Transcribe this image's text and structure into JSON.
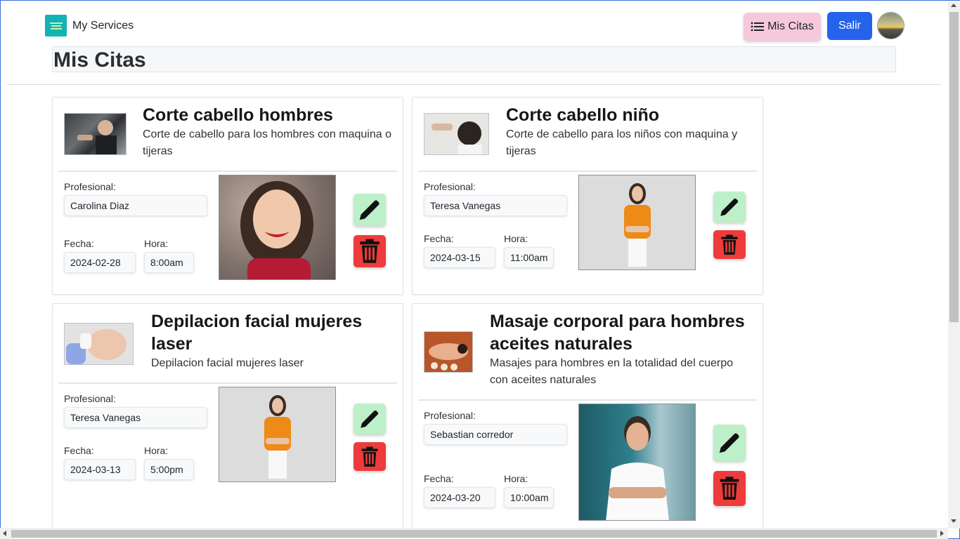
{
  "header": {
    "brand_name": "My Services",
    "mis_citas_label": "Mis Citas",
    "salir_label": "Salir"
  },
  "page_title": "Mis Citas",
  "labels": {
    "profesional": "Profesional:",
    "fecha": "Fecha:",
    "hora": "Hora:"
  },
  "colors": {
    "mis_citas_bg": "#f7c8dc",
    "salir_bg": "#2563eb",
    "edit_bg": "#bdf0c9",
    "delete_bg": "#ef3b3b"
  },
  "appointments": [
    {
      "service_title": "Corte cabello hombres",
      "service_description": "Corte de cabello para los hombres con maquina o tijeras",
      "professional": "Carolina Diaz",
      "date": "2024-02-28",
      "time": "8:00am"
    },
    {
      "service_title": "Corte cabello niño",
      "service_description": "Corte de cabello para los niños con maquina y tijeras",
      "professional": "Teresa Vanegas",
      "date": "2024-03-15",
      "time": "11:00am"
    },
    {
      "service_title": "Depilacion facial mujeres laser",
      "service_description": "Depilacion facial mujeres laser",
      "professional": "Teresa Vanegas",
      "date": "2024-03-13",
      "time": "5:00pm"
    },
    {
      "service_title": "Masaje corporal para hombres aceites naturales",
      "service_description": "Masajes para hombres en la totalidad del cuerpo con aceites naturales",
      "professional": "Sebastian corredor",
      "date": "2024-03-20",
      "time": "10:00am"
    }
  ]
}
